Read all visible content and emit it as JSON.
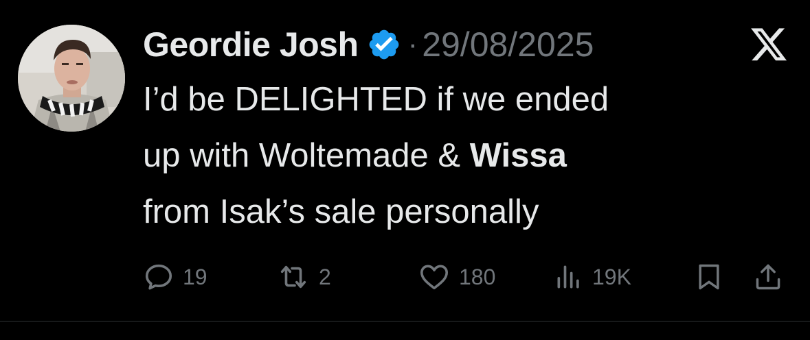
{
  "tweet": {
    "author_name": "Geordie Josh",
    "separator": "·",
    "date": "29/08/2025",
    "text_line1": "I’d be DELIGHTED if we ended",
    "text_line2_part1": "up with Woltemade & ",
    "text_line2_bold": "Wissa",
    "text_line3": "from Isak’s sale personally"
  },
  "actions": {
    "replies": "19",
    "reposts": "2",
    "likes": "180",
    "views": "19K"
  },
  "icons": {
    "verified": "verified-badge-icon",
    "platform": "x-logo-icon",
    "reply": "reply-bubble-icon",
    "repost": "repost-icon",
    "like": "heart-icon",
    "views": "bar-chart-icon",
    "bookmark": "bookmark-icon",
    "share": "share-icon"
  },
  "colors": {
    "background": "#000000",
    "text": "#e7e9ea",
    "muted": "#71767b",
    "verified": "#1d9bf0"
  }
}
